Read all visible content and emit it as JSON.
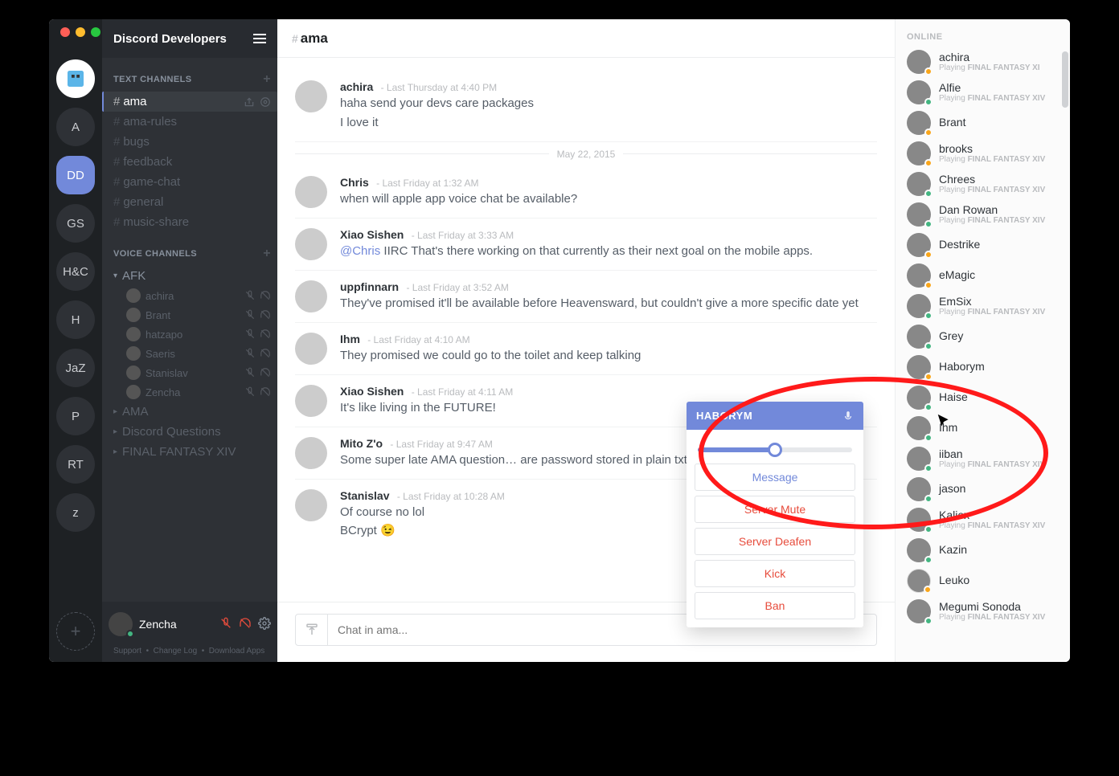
{
  "server_name": "Discord Developers",
  "servers": [
    {
      "label": "",
      "avatar": true
    },
    {
      "label": "A"
    },
    {
      "label": "DD",
      "selected": true
    },
    {
      "label": "GS"
    },
    {
      "label": "H&C"
    },
    {
      "label": "H"
    },
    {
      "label": "JaZ"
    },
    {
      "label": "P"
    },
    {
      "label": "RT"
    },
    {
      "label": "z"
    }
  ],
  "text_channels_header": "TEXT CHANNELS",
  "voice_channels_header": "VOICE CHANNELS",
  "text_channels": [
    {
      "name": "ama",
      "active": true
    },
    {
      "name": "ama-rules",
      "muted": true
    },
    {
      "name": "bugs",
      "muted": true
    },
    {
      "name": "feedback",
      "muted": true
    },
    {
      "name": "game-chat",
      "muted": true
    },
    {
      "name": "general",
      "muted": true
    },
    {
      "name": "music-share",
      "muted": true
    }
  ],
  "voice_channels": [
    {
      "name": "AFK",
      "expanded": true,
      "users": [
        {
          "name": "achira"
        },
        {
          "name": "Brant"
        },
        {
          "name": "hatzapo"
        },
        {
          "name": "Saeris"
        },
        {
          "name": "Stanislav"
        },
        {
          "name": "Zencha"
        }
      ]
    },
    {
      "name": "AMA"
    },
    {
      "name": "Discord Questions"
    },
    {
      "name": "FINAL FANTASY XIV"
    }
  ],
  "current_user": {
    "name": "Zencha"
  },
  "footer": {
    "support": "Support",
    "changelog": "Change Log",
    "download": "Download Apps"
  },
  "channel_title": "ama",
  "date_divider": "May 22, 2015",
  "messages": [
    {
      "author": "achira",
      "ts": "Last Thursday at 4:40 PM",
      "lines": [
        "haha send your devs care packages",
        "I love it"
      ],
      "avatar": "c0"
    },
    {
      "author": "Chris",
      "ts": "Last Friday at 1:32 AM",
      "lines": [
        "when will apple app voice chat be available?"
      ],
      "avatar": "c1"
    },
    {
      "author": "Xiao Sishen",
      "ts": "Last Friday at 3:33 AM",
      "mention": "@Chris",
      "text_after": " IIRC That's there working on that currently as their next goal on the mobile apps.",
      "avatar": "c2"
    },
    {
      "author": "uppfinnarn",
      "ts": "Last Friday at 3:52 AM",
      "lines": [
        "They've promised it'll be available before Heavensward, but couldn't give a more specific date yet"
      ],
      "avatar": "c3"
    },
    {
      "author": "Ihm",
      "ts": "Last Friday at 4:10 AM",
      "lines": [
        "They promised we could go to the toilet and keep talking"
      ],
      "avatar": "c4"
    },
    {
      "author": "Xiao Sishen",
      "ts": "Last Friday at 4:11 AM",
      "lines": [
        "It's like living in the FUTURE!"
      ],
      "avatar": "c2"
    },
    {
      "author": "Mito Z'o",
      "ts": "Last Friday at 9:47 AM",
      "lines": [
        "Some super late AMA question… are password stored in plain txt?"
      ],
      "avatar": "c5"
    },
    {
      "author": "Stanislav",
      "ts": "Last Friday at 10:28 AM",
      "lines": [
        "Of course no lol",
        "BCrypt 😉"
      ],
      "avatar": "c6"
    }
  ],
  "composer_placeholder": "Chat in ama...",
  "members_group": "ONLINE",
  "members": [
    {
      "name": "achira",
      "playing": "FINAL FANTASY XI",
      "status": "idle",
      "c": "m0"
    },
    {
      "name": "Alfie",
      "playing": "FINAL FANTASY XIV",
      "status": "online",
      "c": "m1"
    },
    {
      "name": "Brant",
      "status": "idle",
      "c": "m2"
    },
    {
      "name": "brooks",
      "playing": "FINAL FANTASY XIV",
      "status": "idle",
      "c": "m3"
    },
    {
      "name": "Chrees",
      "playing": "FINAL FANTASY XIV",
      "status": "online",
      "c": "m4"
    },
    {
      "name": "Dan Rowan",
      "playing": "FINAL FANTASY XIV",
      "status": "online",
      "c": "m5"
    },
    {
      "name": "Destrike",
      "status": "idle",
      "c": "m6"
    },
    {
      "name": "eMagic",
      "status": "idle",
      "c": "m7"
    },
    {
      "name": "EmSix",
      "playing": "FINAL FANTASY XIV",
      "status": "online",
      "c": "m8"
    },
    {
      "name": "Grey",
      "status": "online",
      "c": "m9"
    },
    {
      "name": "Haborym",
      "status": "idle",
      "c": "m10"
    },
    {
      "name": "Haise",
      "status": "online",
      "c": "m11"
    },
    {
      "name": "Ihm",
      "status": "online",
      "c": "m12"
    },
    {
      "name": "iiban",
      "playing": "FINAL FANTASY XIV",
      "status": "online",
      "c": "m13"
    },
    {
      "name": "jason",
      "status": "online",
      "c": "m14"
    },
    {
      "name": "Kaliex",
      "playing": "FINAL FANTASY XIV",
      "status": "online",
      "c": "m15"
    },
    {
      "name": "Kazin",
      "status": "online",
      "c": "m16"
    },
    {
      "name": "Leuko",
      "status": "idle",
      "c": "m17"
    },
    {
      "name": "Megumi Sonoda",
      "playing": "FINAL FANTASY XIV",
      "status": "online",
      "c": "m18"
    }
  ],
  "playing_prefix": "Playing ",
  "popover": {
    "name": "HABORYM",
    "slider_percent": 50,
    "actions": [
      {
        "label": "Message",
        "kind": "blue"
      },
      {
        "label": "Server Mute",
        "kind": "red"
      },
      {
        "label": "Server Deafen",
        "kind": "red"
      },
      {
        "label": "Kick",
        "kind": "red"
      },
      {
        "label": "Ban",
        "kind": "red"
      }
    ]
  }
}
